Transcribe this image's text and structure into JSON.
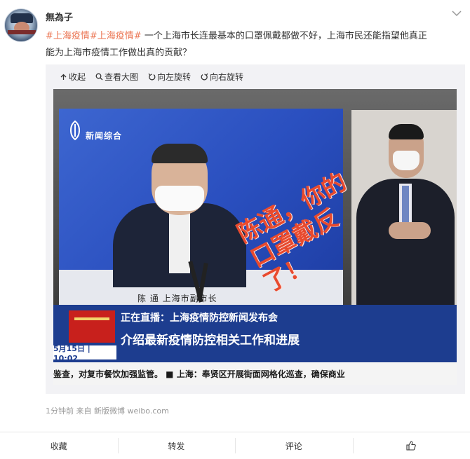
{
  "post": {
    "username": "無為子",
    "topic1": "#上海疫情#",
    "topic2": "上海疫情#",
    "text_line1": " 一个上海市长连最基本的口罩佩戴都做不好，上海市民还能指望他真正",
    "text_line2": "能为上海市疫情工作做出真的贡献？",
    "time": "1分钟前",
    "source_label": "来自",
    "source": "新版微博 weibo.com"
  },
  "toolbar": {
    "collapse_label": "收起",
    "view_large_label": "查看大图",
    "rotate_left_label": "向左旋转",
    "rotate_right_label": "向右旋转"
  },
  "image": {
    "station_name": "新闻综合",
    "nameplate": "陈  通    上海市副市长",
    "overlay_line1": "陈通，你的",
    "overlay_line2": "口罩戴反",
    "overlay_line3": "了！",
    "ticker_live": "正在直播：上海疫情防控新闻发布会",
    "ticker_headline": "介绍最新疫情防控相关工作和进展",
    "ticker_date": "5月15日 | 10:02",
    "ticker_scroll": "鉴查，对复市餐饮加强监管。    ■ 上海：奉贤区开展街面网格化巡查，确保商业"
  },
  "actions": {
    "favorite": "收藏",
    "repost": "转发",
    "comment": "评论"
  },
  "colors": {
    "topic": "#eb7350",
    "ticker_bg": "#1d3d8f",
    "overlay_text": "#e84a2e"
  }
}
